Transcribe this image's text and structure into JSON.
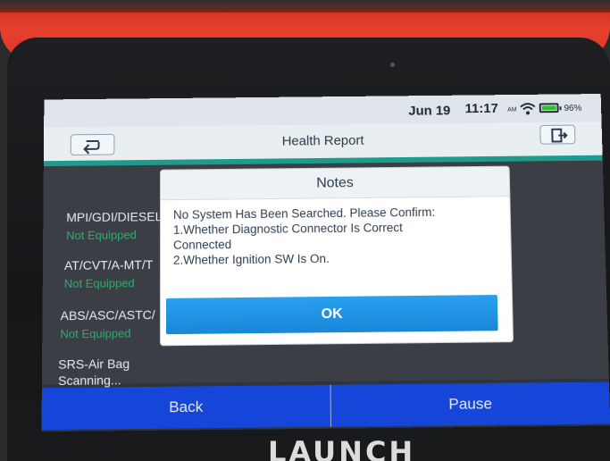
{
  "status_bar": {
    "date": "Jun 19",
    "time": "11:17",
    "time_suffix": "AM",
    "battery": "96%",
    "wifi_icon": "wifi-icon",
    "battery_icon": "battery-icon"
  },
  "header": {
    "title": "Health Report",
    "back_icon": "back-arrow-icon",
    "exit_icon": "exit-icon"
  },
  "systems": [
    {
      "name": "MPI/GDI/DIESEL",
      "status": "Not Equipped"
    },
    {
      "name": "AT/CVT/A-MT/T",
      "status": "Not Equipped"
    },
    {
      "name": "ABS/ASC/ASTC/",
      "status": "Not Equipped"
    },
    {
      "name": "SRS-Air Bag",
      "status": "Scanning..."
    }
  ],
  "dialog": {
    "title": "Notes",
    "lines": [
      "No System Has Been Searched. Please Confirm:",
      " 1.Whether Diagnostic Connector Is Correct",
      "Connected",
      " 2.Whether Ignition SW Is On."
    ],
    "ok_label": "OK"
  },
  "footer": {
    "back_label": "Back",
    "pause_label": "Pause"
  },
  "device": {
    "brand": "LAUNCH"
  },
  "colors": {
    "accent_blue": "#1646d9",
    "ok_blue": "#1a86d8",
    "status_green": "#28b06b",
    "teal": "#1e9b8c"
  }
}
